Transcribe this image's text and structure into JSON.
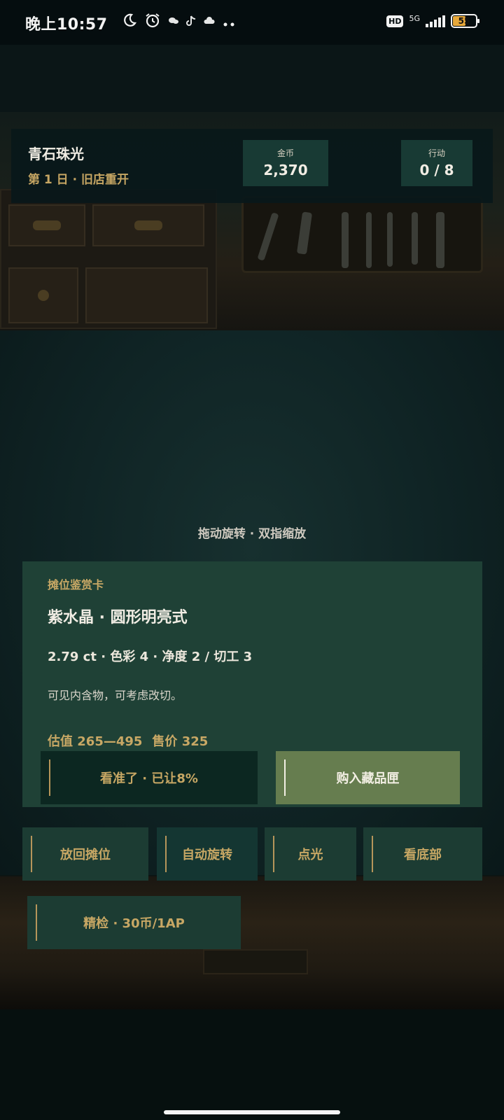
{
  "status_bar": {
    "time": "晚上10:57",
    "icons": [
      "moon-icon",
      "alarm-icon",
      "chat-icon",
      "tiktok-icon",
      "cloud-icon",
      "more-icon"
    ],
    "hd": "HD",
    "network": "5G",
    "battery": "55",
    "battery_level": 0.55,
    "battery_color": "#e7a83a"
  },
  "hud": {
    "shop_name": "青石珠光",
    "day_line": "第 1 日 · 旧店重开",
    "coins_label": "金币",
    "coins_value": "2,370",
    "ap_label": "行动",
    "ap_value": "0 / 8"
  },
  "hint": "拖动旋转 · 双指缩放",
  "card": {
    "kicker": "摊位鉴赏卡",
    "title": "紫水晶 · 圆形明亮式",
    "specs": "2.79 ct · 色彩 4 · 净度 2 / 切工 3",
    "note": "可见内含物，可考虑改切。",
    "estimate": "估值 265—495",
    "price": "售价 325"
  },
  "buttons": {
    "accept": "看准了 · 已让8%",
    "buy": "购入藏品匣",
    "return": "放回摊位",
    "auto_rotate": "自动旋转",
    "light": "点光",
    "view_bottom": "看底部",
    "inspect": "精检 · 30币/1AP"
  },
  "colors": {
    "accent_gold": "#c8a865",
    "card_green": "#1f4136",
    "buy_green": "#667d4f"
  }
}
